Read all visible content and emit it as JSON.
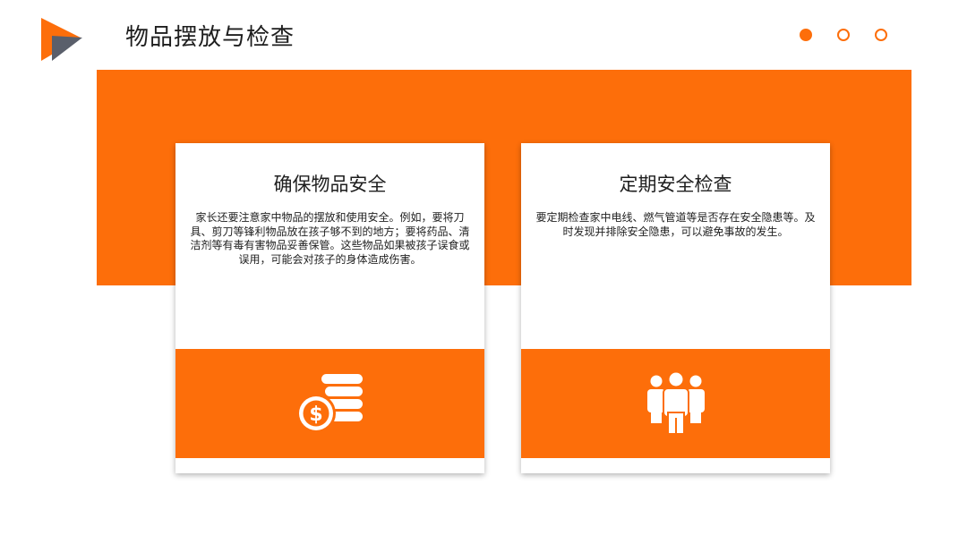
{
  "header": {
    "title": "物品摆放与检查",
    "logo_icon": "play-arrow-logo-icon",
    "pager_dots": [
      {
        "active": true
      },
      {
        "active": false
      },
      {
        "active": false
      }
    ]
  },
  "colors": {
    "accent": "#fd6e0a",
    "logo_dark": "#5a5f6b",
    "text": "#1e1e1e"
  },
  "cards": [
    {
      "title": "确保物品安全",
      "text": "家长还要注意家中物品的摆放和使用安全。例如，要将刀具、剪刀等锋利物品放在孩子够不到的地方；要将药品、清洁剂等有毒有害物品妥善保管。这些物品如果被孩子误食或误用，可能会对孩子的身体造成伤害。",
      "icon": "coin-stack-dollar-icon"
    },
    {
      "title": "定期安全检查",
      "text": "要定期检查家中电线、燃气管道等是否存在安全隐患等。及时发现并排除安全隐患，可以避免事故的发生。",
      "icon": "people-group-icon"
    }
  ]
}
